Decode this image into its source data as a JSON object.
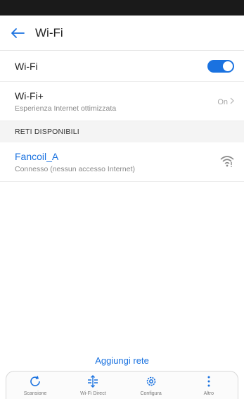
{
  "header": {
    "title": "Wi-Fi"
  },
  "wifi_row": {
    "label": "Wi-Fi",
    "enabled": true
  },
  "wifi_plus_row": {
    "label": "Wi-Fi+",
    "subtitle": "Esperienza Internet ottimizzata",
    "status": "On"
  },
  "section": {
    "available_networks": "RETI DISPONIBILI"
  },
  "networks": [
    {
      "name": "Fancoil_A",
      "status": "Connesso (nessun accesso Internet)",
      "icon": "wifi-no-internet-icon"
    }
  ],
  "actions": {
    "add_network": "Aggiungi rete"
  },
  "bottom_bar": [
    {
      "label": "Scansione",
      "icon": "refresh-icon"
    },
    {
      "label": "Wi-Fi Direct",
      "icon": "wifi-direct-icon"
    },
    {
      "label": "Configura",
      "icon": "gear-icon"
    },
    {
      "label": "Altro",
      "icon": "more-icon"
    }
  ],
  "colors": {
    "accent": "#1a72e0",
    "status_bar": "#1a1a1a"
  }
}
